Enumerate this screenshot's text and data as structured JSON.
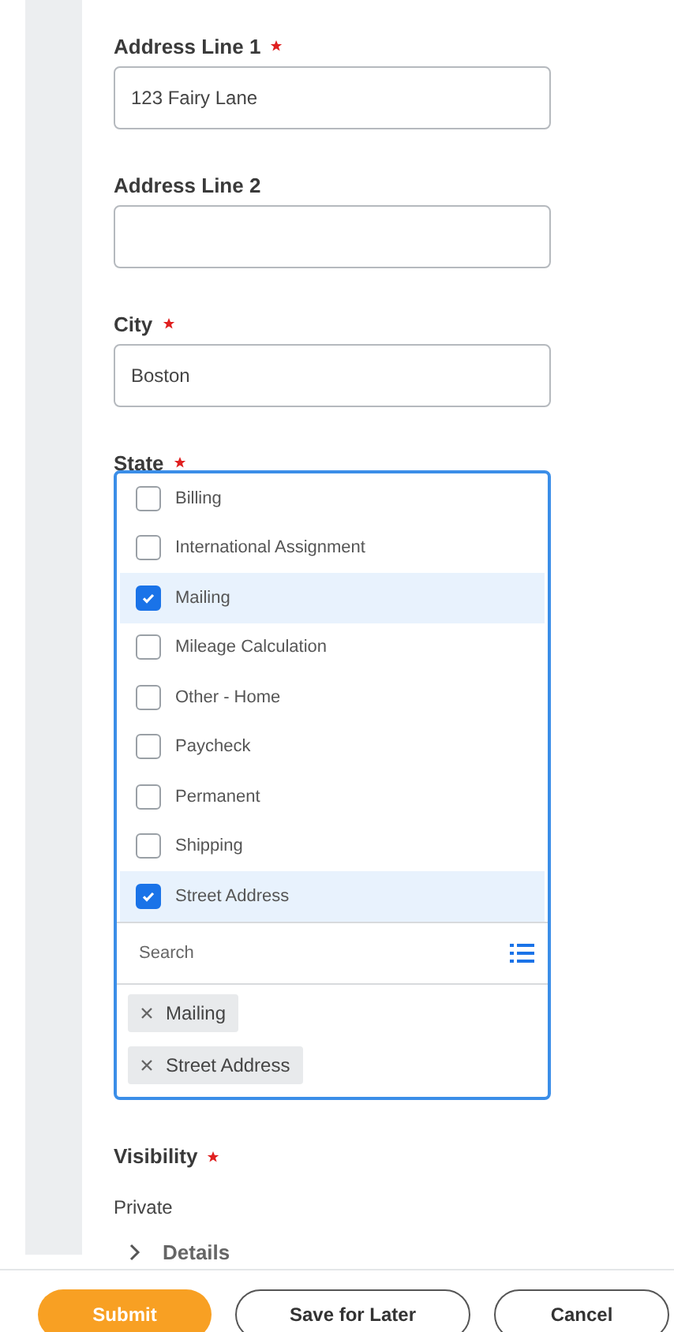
{
  "fields": [
    {
      "label": "Address Line 1",
      "required": true,
      "value": "123 Fairy Lane"
    },
    {
      "label": "Address Line 2",
      "required": false
    },
    {
      "label": "City",
      "required": true,
      "value": "Boston"
    }
  ],
  "state_field": {
    "label": "State",
    "required": true,
    "options": [
      {
        "label": "Billing",
        "checked": false
      },
      {
        "label": "International Assignment",
        "checked": false
      },
      {
        "label": "Mailing",
        "checked": true
      },
      {
        "label": "Mileage Calculation",
        "checked": false
      },
      {
        "label": "Other - Home",
        "checked": false
      },
      {
        "label": "Paycheck",
        "checked": false
      },
      {
        "label": "Permanent",
        "checked": false
      },
      {
        "label": "Shipping",
        "checked": false
      },
      {
        "label": "Street Address",
        "checked": true
      }
    ],
    "search": {
      "placeholder": "Search"
    },
    "selected_pills": [
      "Mailing",
      "Street Address"
    ]
  },
  "visibility": {
    "label": "Visibility",
    "required": true,
    "value": "Private"
  },
  "details_section": {
    "label": "Details"
  },
  "buttons": [
    {
      "label": "Submit",
      "kind": "primary"
    },
    {
      "label": "Save for Later",
      "kind": "secondary"
    },
    {
      "label": "Cancel",
      "kind": "secondary"
    }
  ]
}
